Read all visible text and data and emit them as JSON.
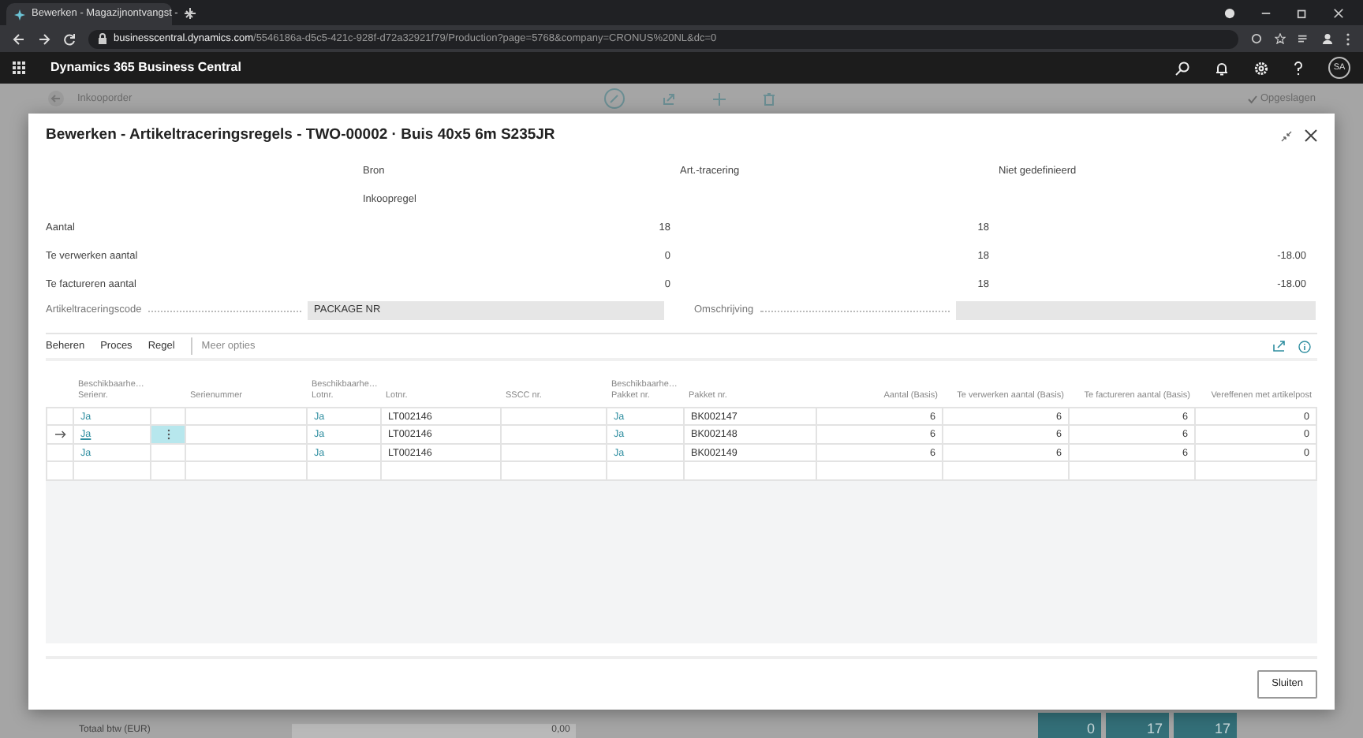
{
  "browser": {
    "tab_title": "Bewerken - Magazijnontvangst -",
    "url_host": "businesscentral.dynamics.com",
    "url_path": "/5546186a-d5c5-421c-928f-d72a32921f79/Production?page=5768&company=CRONUS%20NL&dc=0"
  },
  "app_bar": {
    "title": "Dynamics 365 Business Central",
    "avatar": "SA"
  },
  "background_page": {
    "title": "Inkooporder",
    "status": "Opgeslagen",
    "totals": [
      {
        "label": "Totaal btw (EUR)",
        "value": "0,00"
      }
    ],
    "tiles": [
      "0",
      "17",
      "17"
    ]
  },
  "dialog": {
    "title": "Bewerken - Artikeltraceringsregels - TWO-00002 · Buis 40x5 6m S235JR",
    "summary": {
      "columns": [
        "Bron",
        "Art.-tracering",
        "Niet gedefinieerd"
      ],
      "source_label": "Inkoopregel",
      "rows": [
        {
          "label": "Aantal",
          "cells": [
            "18",
            "18",
            null
          ]
        },
        {
          "label": "Te verwerken aantal",
          "cells": [
            "0",
            "18",
            "-18.00"
          ]
        },
        {
          "label": "Te factureren aantal",
          "cells": [
            "0",
            "18",
            "-18.00"
          ]
        }
      ]
    },
    "fields": [
      {
        "label": "Artikeltraceringscode",
        "value": "PACKAGE NR"
      },
      {
        "label": "Omschrijving"
      }
    ],
    "actions": [
      "Beheren",
      "Proces",
      "Regel"
    ],
    "more_options": "Meer opties",
    "table": {
      "columns": [
        {
          "lines": [
            "Beschikbaarhe…",
            "Serienr."
          ],
          "kind": "link"
        },
        {
          "lines": [
            "Serienummer"
          ],
          "kind": "text"
        },
        {
          "lines": [
            "Beschikbaarhe…",
            "Lotnr."
          ],
          "kind": "link"
        },
        {
          "lines": [
            "Lotnr."
          ],
          "kind": "text"
        },
        {
          "lines": [
            "SSCC nr."
          ],
          "kind": "text"
        },
        {
          "lines": [
            "Beschikbaarhe…",
            "Pakket nr."
          ],
          "kind": "link"
        },
        {
          "lines": [
            "Pakket nr."
          ],
          "kind": "text"
        },
        {
          "lines": [
            "Aantal (Basis)"
          ],
          "kind": "number"
        },
        {
          "lines": [
            "Te verwerken aantal (Basis)"
          ],
          "kind": "number"
        },
        {
          "lines": [
            "Te factureren aantal (Basis)"
          ],
          "kind": "number"
        },
        {
          "lines": [
            "Vereffenen met artikelpost"
          ],
          "kind": "number"
        }
      ],
      "rows": [
        {
          "selected": false,
          "cells": [
            "Ja",
            null,
            "Ja",
            "LT002146",
            null,
            "Ja",
            "BK002147",
            "6",
            "6",
            "6",
            "0"
          ]
        },
        {
          "selected": true,
          "cells": [
            "Ja",
            null,
            "Ja",
            "LT002146",
            null,
            "Ja",
            "BK002148",
            "6",
            "6",
            "6",
            "0"
          ]
        },
        {
          "selected": false,
          "cells": [
            "Ja",
            null,
            "Ja",
            "LT002146",
            null,
            "Ja",
            "BK002149",
            "6",
            "6",
            "6",
            "0"
          ]
        }
      ]
    },
    "close_button": "Sluiten"
  }
}
